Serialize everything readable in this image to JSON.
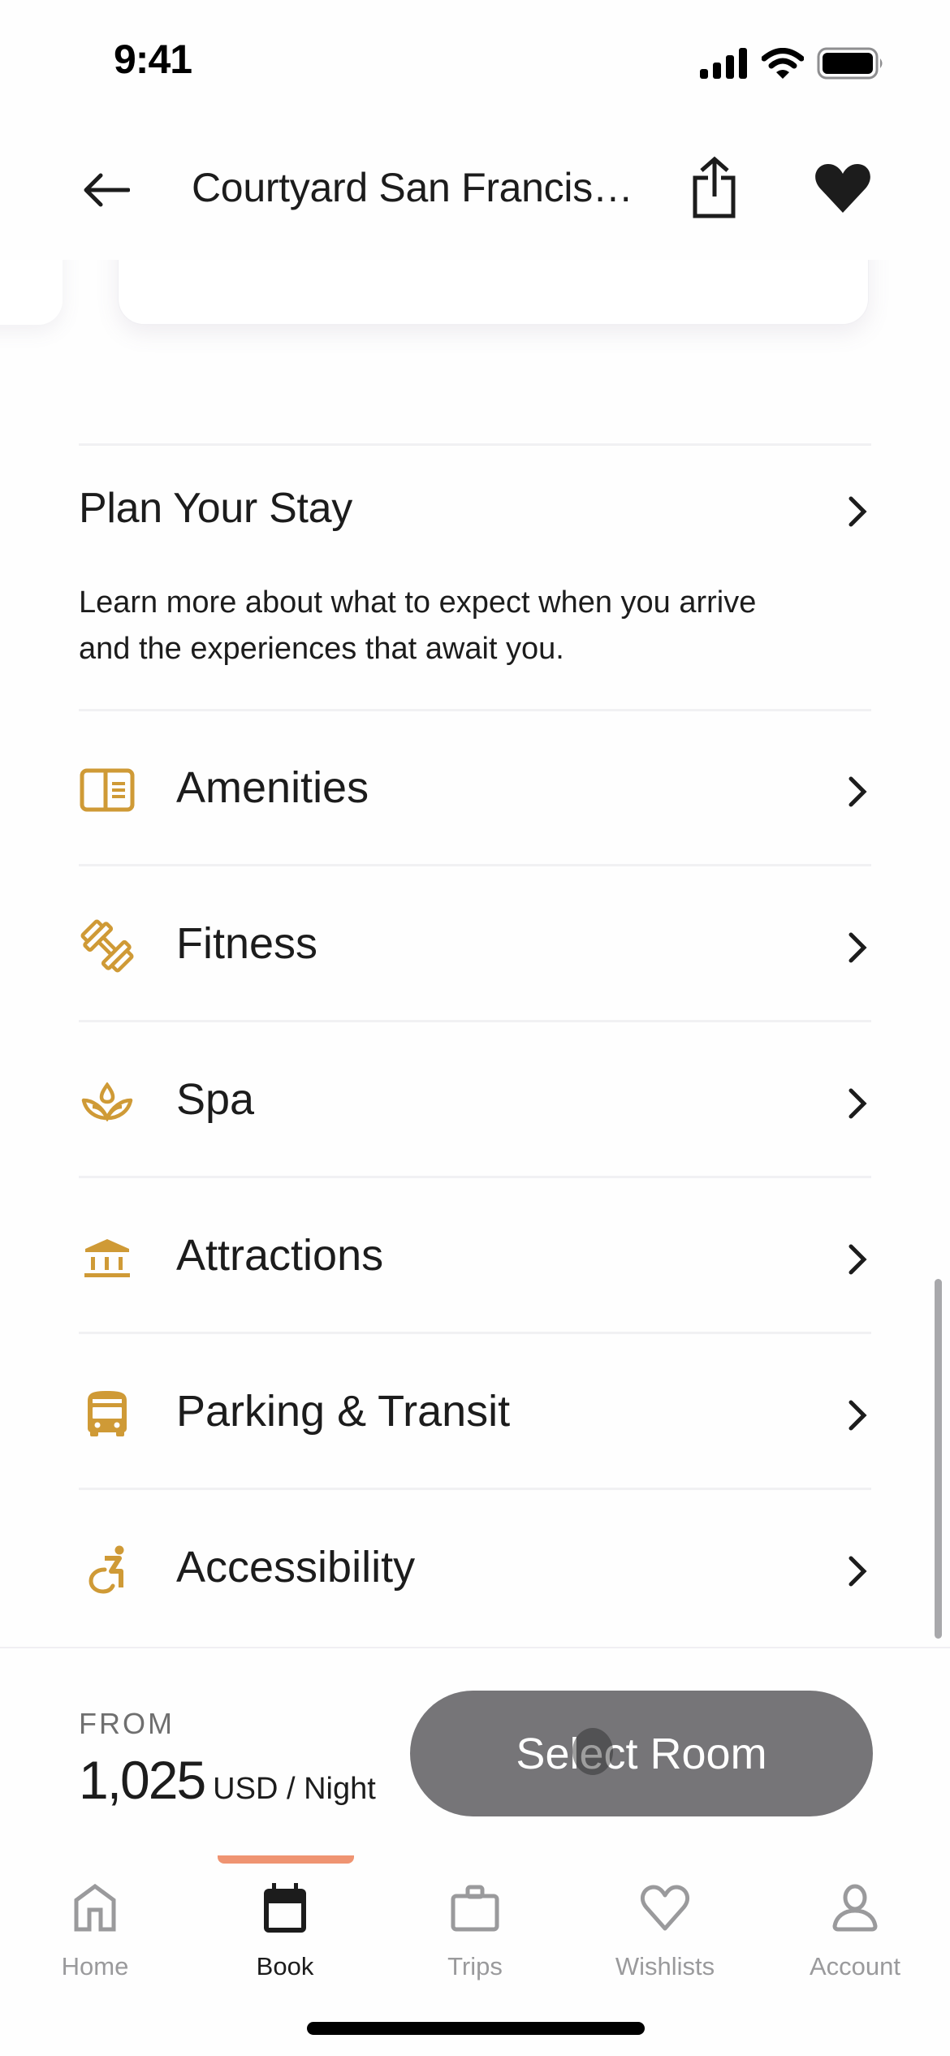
{
  "status_bar": {
    "time": "9:41",
    "icons": [
      "cellular-signal-icon",
      "wifi-icon",
      "battery-icon"
    ]
  },
  "header": {
    "back_icon": "arrow-left-icon",
    "title": "Courtyard San Francis…",
    "share_icon": "share-icon",
    "favorite_icon": "heart-filled-icon"
  },
  "plan_your_stay": {
    "title": "Plan Your Stay",
    "description": "Learn more about what to expect when you arrive and the experiences that await you."
  },
  "list": {
    "items": [
      {
        "label": "Amenities",
        "icon": "book-open-icon"
      },
      {
        "label": "Fitness",
        "icon": "dumbbell-icon"
      },
      {
        "label": "Spa",
        "icon": "lotus-icon"
      },
      {
        "label": "Attractions",
        "icon": "museum-icon"
      },
      {
        "label": "Parking & Transit",
        "icon": "bus-icon"
      },
      {
        "label": "Accessibility",
        "icon": "wheelchair-icon"
      }
    ]
  },
  "booking": {
    "from_label": "FROM",
    "price": "1,025",
    "unit": "USD / Night",
    "button_label": "Select Room"
  },
  "tab_bar": {
    "active": "Book",
    "tabs": [
      {
        "label": "Home",
        "icon": "home-icon"
      },
      {
        "label": "Book",
        "icon": "calendar-icon"
      },
      {
        "label": "Trips",
        "icon": "suitcase-icon"
      },
      {
        "label": "Wishlists",
        "icon": "heart-outline-icon"
      },
      {
        "label": "Account",
        "icon": "person-icon"
      }
    ]
  },
  "colors": {
    "accent_gold": "#cf9a36",
    "button_gray": "#767578",
    "active_tab_indicator": "#ef9472",
    "inactive_tab": "#9a9a9c",
    "text_primary": "#1c1c1c"
  }
}
